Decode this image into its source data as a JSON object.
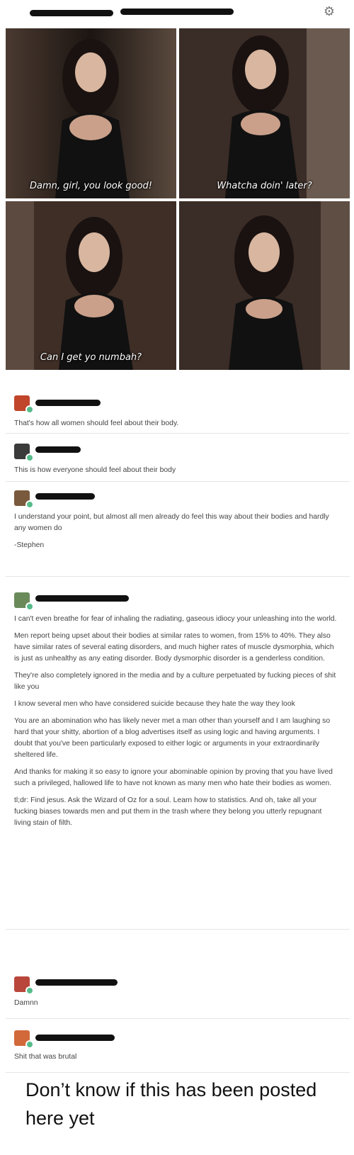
{
  "header": {
    "settings_icon": "gear-icon"
  },
  "panels": [
    {
      "caption": "Damn, girl, you look good!"
    },
    {
      "caption": "Whatcha doin' later?"
    },
    {
      "caption": "Can I get yo numbah?"
    },
    {
      "caption": ""
    }
  ],
  "comments": [
    {
      "avatar_color": "#c0452b",
      "paragraphs": [
        "That's how all women should feel about their body."
      ]
    },
    {
      "avatar_color": "#3b3b3b",
      "paragraphs": [
        "This is how everyone should feel about their body"
      ]
    },
    {
      "avatar_color": "#7a5a3c",
      "paragraphs": [
        "I understand your point, but almost all men already do feel this way about their bodies and hardly any women do",
        "-Stephen"
      ]
    },
    {
      "avatar_color": "#6a8a5a",
      "paragraphs": [
        "I can't even breathe for fear of inhaling the radiating, gaseous idiocy your unleashing into the world.",
        "Men report being upset about their bodies at similar rates to women, from 15% to 40%. They also have similar rates of several eating disorders, and much higher rates of muscle dysmorphia, which is just as unhealthy as any eating disorder. Body dysmorphic disorder is a genderless condition.",
        "They're also completely ignored in the media and by a culture perpetuated by fucking pieces of shit like you",
        "I know several men who have considered suicide because they hate the way they look",
        "You are an abomination who has likely never met a man other than yourself and I am laughing so hard that your shitty, abortion of a blog advertises itself as using logic and having arguments. I doubt that you've been particularly exposed to either logic or arguments in your extraordinarily sheltered life.",
        "And thanks for making it so easy to ignore your abominable opinion by proving that you have lived such a privileged, hallowed life to have not known as many men who hate their bodies as women.",
        "tl;dr: Find jesus. Ask the Wizard of Oz for a soul. Learn how to statistics. And oh, take all your fucking biases towards men and put them in the trash where they belong you utterly repugnant living stain of filth."
      ]
    },
    {
      "avatar_color": "#b9463a",
      "paragraphs": [
        "Damnn"
      ]
    },
    {
      "avatar_color": "#d2693a",
      "paragraphs": [
        "Shit that was brutal"
      ]
    }
  ],
  "footer": {
    "text": "Don’t know if this has been posted here yet"
  }
}
